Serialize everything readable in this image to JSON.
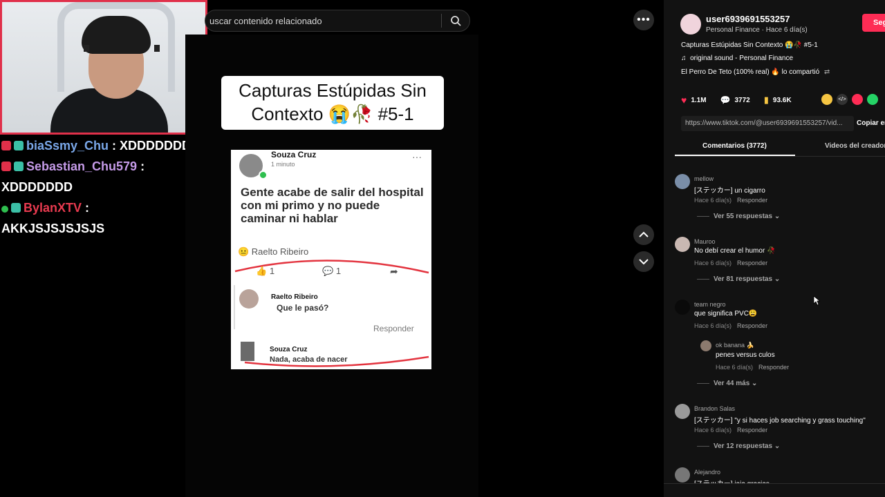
{
  "search": {
    "placeholder": "uscar contenido relacionado"
  },
  "chat": [
    {
      "user": "biaSsmy_Chu",
      "user_color": "#7aa7e8",
      "sep": " : ",
      "message": "XDDDDDDD"
    },
    {
      "user": "Sebastian_Chu579",
      "user_color": "#c59be8",
      "sep": " :",
      "message": "XDDDDDDD"
    },
    {
      "user": "BylanXTV",
      "user_color": "#e83a4f",
      "sep": " :",
      "message": "AKKJSJSJSJSJS"
    }
  ],
  "video": {
    "title_line1": "Capturas Estúpidas Sin",
    "title_line2": "Contexto 😭🥀 #5-1",
    "post": {
      "author": "Souza Cruz",
      "time": "1 minuto",
      "body": "Gente acabe de salir del hospital con mi primo y no puede caminar ni hablar",
      "reactor": "😐 Raelto Ribeiro",
      "likes": "1",
      "comments": "1",
      "reply1_author": "Raelto Ribeiro",
      "reply1_text": "Que le pasó?",
      "reply1_action": "Responder",
      "reply2_author": "Souza Cruz",
      "reply2_text": "Nada, acaba de nacer"
    }
  },
  "panel": {
    "username": "user6939691553257",
    "subtitle": "Personal Finance · Hace 6 día(s)",
    "follow_label": "Seg",
    "description": "Capturas Estúpidas Sin Contexto 😭🥀 #5-1",
    "sound": "original sound - Personal Finance",
    "shared_by": "El Perro De Teto (100% real) 🔥 lo compartió",
    "stats": {
      "likes": "1.1M",
      "comments": "3772",
      "saves": "93.6K"
    },
    "link": "https://www.tiktok.com/@user6939691553257/vid...",
    "copy_label": "Copiar en",
    "tabs": [
      "Comentarios (3772)",
      "Videos del creador"
    ],
    "comments": [
      {
        "user": "mellow",
        "text": "[ステッカー] un cigarro",
        "time": "Hace 6 día(s)",
        "reply": "Responder",
        "more": "Ver 55 respuestas"
      },
      {
        "user": "Mauroo",
        "text": "No debí crear el humor 🥀",
        "time": "Hace 6 día(s)",
        "reply": "Responder",
        "more": "Ver 81 respuestas"
      },
      {
        "user": "team negro",
        "text": "que significa PVC😩",
        "time": "Hace 6 día(s)",
        "reply": "Responder",
        "nested": {
          "user": "ok banana 🍌",
          "text": "penes versus culos",
          "time": "Hace 6 día(s)",
          "reply": "Responder"
        },
        "more": "Ver 44 más"
      },
      {
        "user": "Brandon Salas",
        "text": "[ステッカー] \"y si haces job searching y grass touching\"",
        "time": "Hace 6 día(s)",
        "reply": "Responder",
        "more": "Ver 12 respuestas"
      },
      {
        "user": "Alejandro",
        "text": "[ステッカー] jaja gracias"
      }
    ]
  }
}
